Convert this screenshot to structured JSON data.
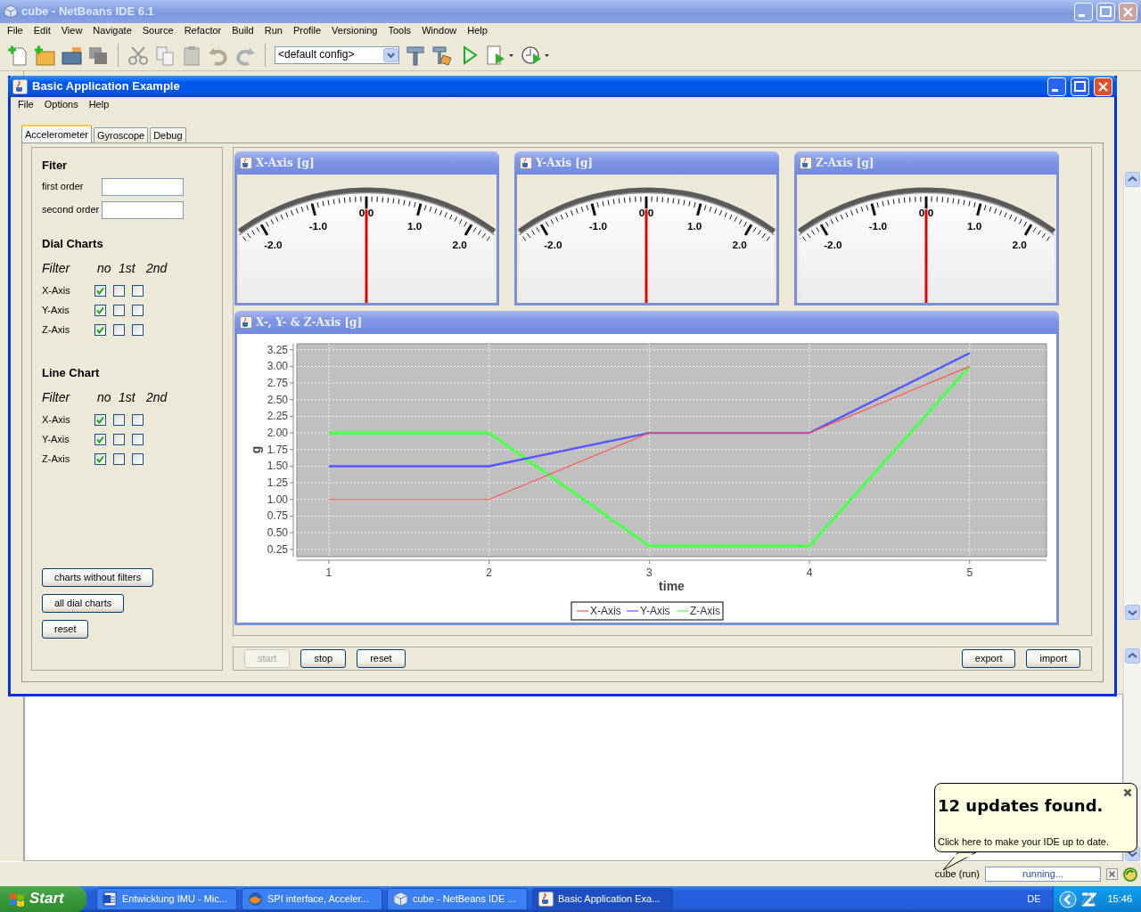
{
  "ide": {
    "title": "cube - NetBeans IDE 6.1",
    "menu": [
      "File",
      "Edit",
      "View",
      "Navigate",
      "Source",
      "Refactor",
      "Build",
      "Run",
      "Profile",
      "Versioning",
      "Tools",
      "Window",
      "Help"
    ],
    "config": "<default config>"
  },
  "app": {
    "title": "Basic Application Example",
    "menu": [
      "File",
      "Options",
      "Help"
    ],
    "tabs": [
      {
        "label": "Accelerometer",
        "selected": true
      },
      {
        "label": "Gyroscope",
        "selected": false
      },
      {
        "label": "Debug",
        "selected": false
      }
    ],
    "filter": {
      "heading": "Fiter",
      "fields": [
        {
          "label": "first order"
        },
        {
          "label": "second order"
        }
      ]
    },
    "dial_charts": {
      "heading": "Dial Charts",
      "columns": [
        "Filter",
        "no",
        "1st",
        "2nd"
      ],
      "rows": [
        {
          "label": "X-Axis",
          "checked": [
            true,
            false,
            false
          ]
        },
        {
          "label": "Y-Axis",
          "checked": [
            true,
            false,
            false
          ]
        },
        {
          "label": "Z-Axis",
          "checked": [
            true,
            false,
            false
          ]
        }
      ]
    },
    "line_chart": {
      "heading": "Line Chart",
      "columns": [
        "Filter",
        "no",
        "1st",
        "2nd"
      ],
      "rows": [
        {
          "label": "X-Axis",
          "checked": [
            true,
            false,
            false
          ]
        },
        {
          "label": "Y-Axis",
          "checked": [
            true,
            false,
            false
          ]
        },
        {
          "label": "Z-Axis",
          "checked": [
            true,
            false,
            false
          ]
        }
      ]
    },
    "side_buttons": [
      "charts without filters",
      "all dial charts",
      "reset"
    ],
    "dials": [
      {
        "title": "X-Axis [g]",
        "tick_labels": [
          "-2.0",
          "-1.0",
          "0.0",
          "1.0",
          "2.0"
        ],
        "level": 0.5
      },
      {
        "title": "Y-Axis [g]",
        "tick_labels": [
          "-2.0",
          "-1.0",
          "0.0",
          "1.0",
          "2.0"
        ],
        "level": 0.5
      },
      {
        "title": "Z-Axis [g]",
        "tick_labels": [
          "-2.0",
          "-1.0",
          "0.0",
          "1.0",
          "2.0"
        ],
        "level": 0.5
      }
    ],
    "chart": {
      "title": "X-, Y- & Z-Axis [g]",
      "chart_data": {
        "type": "line",
        "xlabel": "time",
        "ylabel": "g",
        "grid": true,
        "legend": "bottom",
        "x": [
          1,
          2,
          3,
          4,
          5
        ],
        "series": [
          {
            "name": "X-Axis",
            "color": "#ff5555",
            "values": [
              1.0,
              1.0,
              2.0,
              2.0,
              3.0
            ]
          },
          {
            "name": "Y-Axis",
            "color": "#5555ff",
            "values": [
              1.5,
              1.5,
              2.0,
              2.0,
              3.2
            ]
          },
          {
            "name": "Z-Axis",
            "color": "#55ff55",
            "values": [
              2.0,
              2.0,
              0.3,
              0.3,
              3.0
            ]
          }
        ],
        "xlim": [
          0.8,
          5.48
        ],
        "ylim": [
          0.14,
          3.34
        ],
        "xticks": [
          1,
          2,
          3,
          4,
          5
        ],
        "yticks": [
          {
            "value": 0.25,
            "label": "0.25"
          },
          {
            "value": 0.5,
            "label": "0.50"
          },
          {
            "value": 0.75,
            "label": "0.75"
          },
          {
            "value": 1.0,
            "label": "1.00"
          },
          {
            "value": 1.25,
            "label": "1.25"
          },
          {
            "value": 1.5,
            "label": "1.50"
          },
          {
            "value": 1.75,
            "label": "1.75"
          },
          {
            "value": 2.0,
            "label": "2.00"
          },
          {
            "value": 2.25,
            "label": "2.25"
          },
          {
            "value": 2.5,
            "label": "2.50"
          },
          {
            "value": 2.75,
            "label": "2.75"
          },
          {
            "value": 3.0,
            "label": "3.00"
          },
          {
            "value": 3.25,
            "label": "3.25"
          }
        ]
      }
    },
    "run_buttons": [
      {
        "label": "start",
        "disabled": true
      },
      {
        "label": "stop",
        "disabled": false
      },
      {
        "label": "reset",
        "disabled": false
      }
    ],
    "file_buttons": [
      {
        "label": "export",
        "disabled": false
      },
      {
        "label": "import",
        "disabled": false
      }
    ]
  },
  "status_bar": {
    "task": "cube (run)",
    "progress": "running..."
  },
  "balloon": {
    "title": "12 updates found.",
    "text": "Click here to make your IDE up to date."
  },
  "taskbar": {
    "start": "Start",
    "tasks": [
      {
        "label": "Entwicklung IMU - Mic...",
        "selected": false
      },
      {
        "label": "SPI interface, Acceler...",
        "selected": false
      },
      {
        "label": "cube - NetBeans IDE ...",
        "selected": false
      },
      {
        "label": "Basic Application Exa...",
        "selected": true
      }
    ],
    "language": "DE",
    "clock": "15:46"
  }
}
